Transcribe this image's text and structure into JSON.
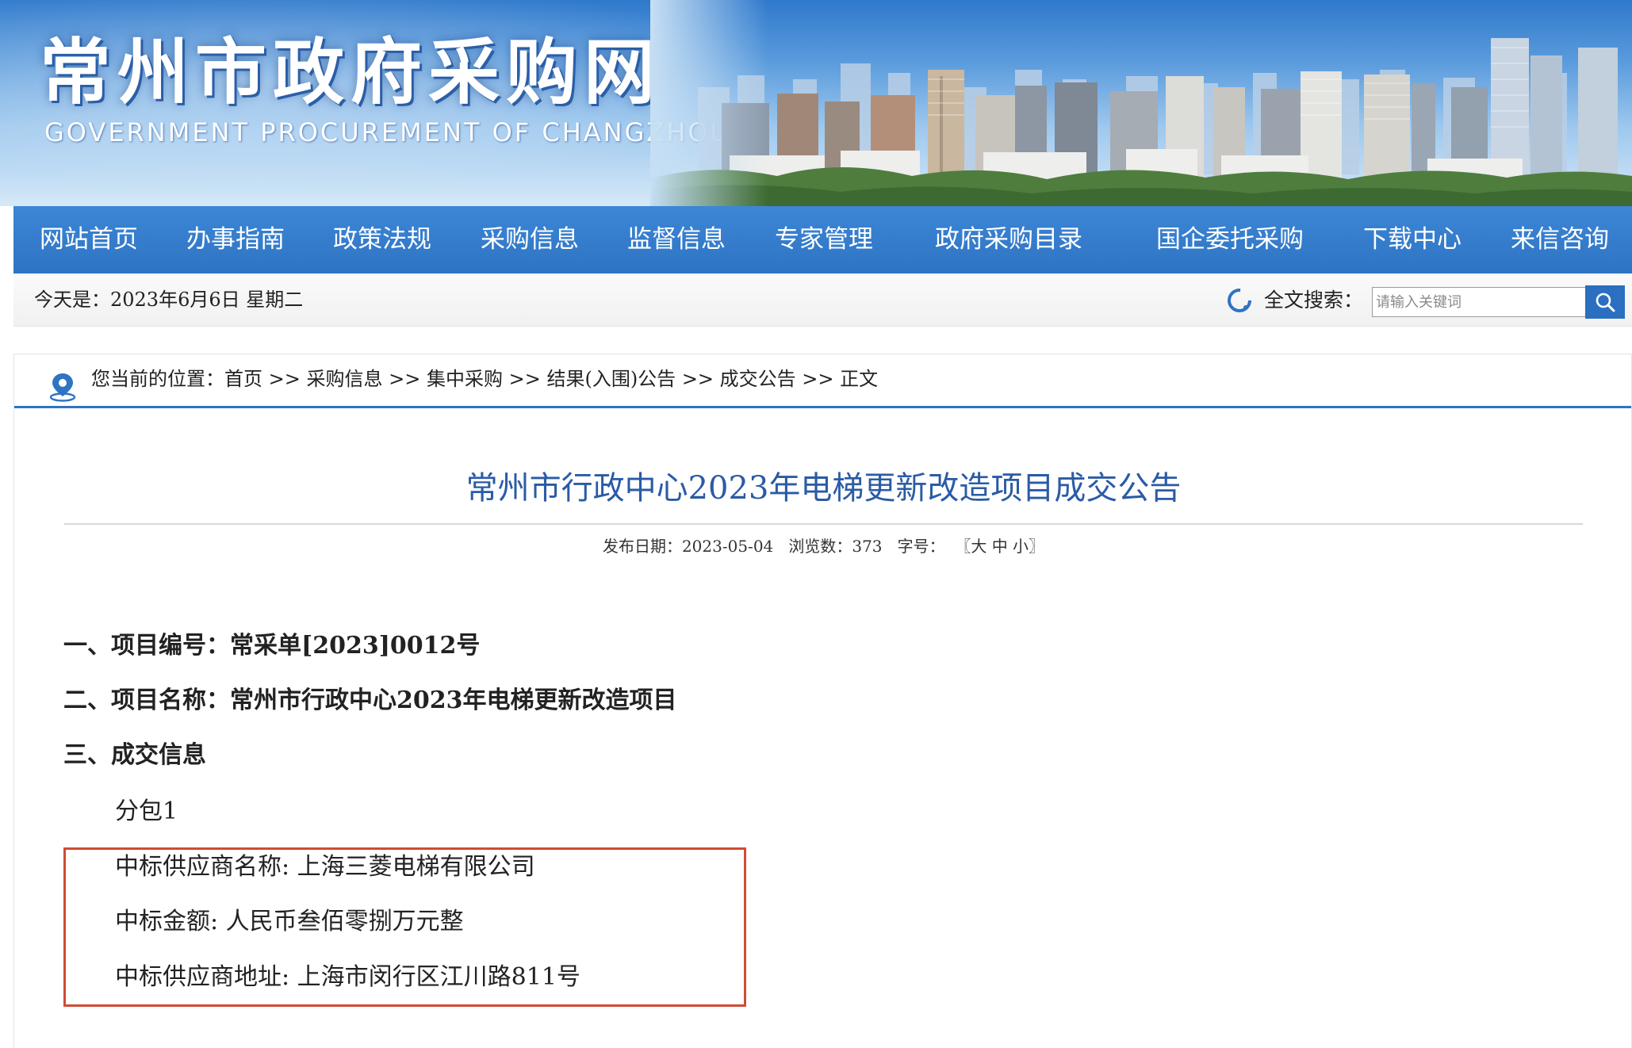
{
  "header": {
    "cn_title": "常州市政府采购网",
    "en_title": "GOVERNMENT PROCUREMENT OF CHANGZHOU"
  },
  "nav": {
    "items": [
      {
        "label": "网站首页"
      },
      {
        "label": "办事指南"
      },
      {
        "label": "政策法规"
      },
      {
        "label": "采购信息"
      },
      {
        "label": "监督信息"
      },
      {
        "label": "专家管理"
      },
      {
        "label": "政府采购目录"
      },
      {
        "label": "国企委托采购"
      },
      {
        "label": "下载中心"
      },
      {
        "label": "来信咨询"
      }
    ]
  },
  "infobar": {
    "date_text": "今天是：2023年6月6日 星期二",
    "search_label": "全文搜索：",
    "search_placeholder": "请输入关键词",
    "search_value": ""
  },
  "breadcrumb": {
    "prefix": "您当前的位置：",
    "items": [
      "首页",
      "采购信息",
      "集中采购",
      "结果(入围)公告",
      "成交公告",
      "正文"
    ],
    "separator": " >> "
  },
  "article": {
    "title": "常州市行政中心2023年电梯更新改造项目成交公告",
    "meta": {
      "date_label": "发布日期：",
      "date": "2023-05-04",
      "views_label": "浏览数：",
      "views": "373",
      "font_label": "字号：",
      "bracket_open": "〖",
      "size_large": "大",
      "size_medium": "中",
      "size_small": "小",
      "bracket_close": "〗"
    },
    "sections": {
      "s1": "一、项目编号：常采单[2023]0012号",
      "s2": "二、项目名称：常州市行政中心2023年电梯更新改造项目",
      "s3": "三、成交信息",
      "package": "分包1",
      "supplier_name": "中标供应商名称: 上海三菱电梯有限公司",
      "amount": "中标金额: 人民币叁佰零捌万元整",
      "supplier_address": "中标供应商地址: 上海市闵行区江川路811号"
    }
  },
  "colors": {
    "nav_bg": "#2e74c3",
    "title_blue": "#2a5ba6",
    "highlight_border": "#d14b35"
  }
}
